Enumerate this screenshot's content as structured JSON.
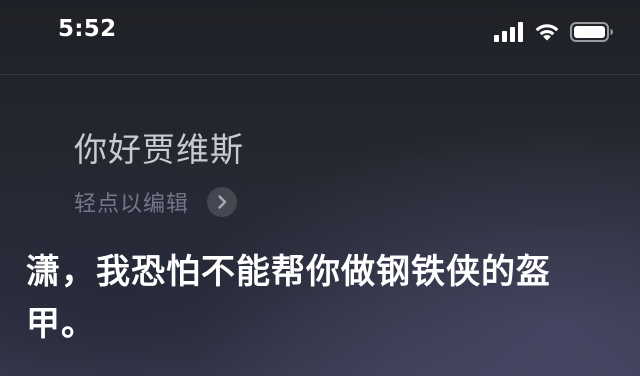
{
  "status_bar": {
    "time": "5:52",
    "icons": [
      "cellular-signal-icon",
      "wifi-icon",
      "battery-icon"
    ]
  },
  "siri": {
    "query": "你好贾维斯",
    "edit_hint": "轻点以编辑",
    "edit_chevron_icon": "chevron-right-icon",
    "response": "潇，我恐怕不能帮你做钢铁侠的盔甲。"
  },
  "colors": {
    "background_top": "#1f2127",
    "background_bottom": "#3a3b50",
    "query_text": "#c9cad3",
    "hint_text": "#74768a",
    "response_text": "#ffffff"
  }
}
